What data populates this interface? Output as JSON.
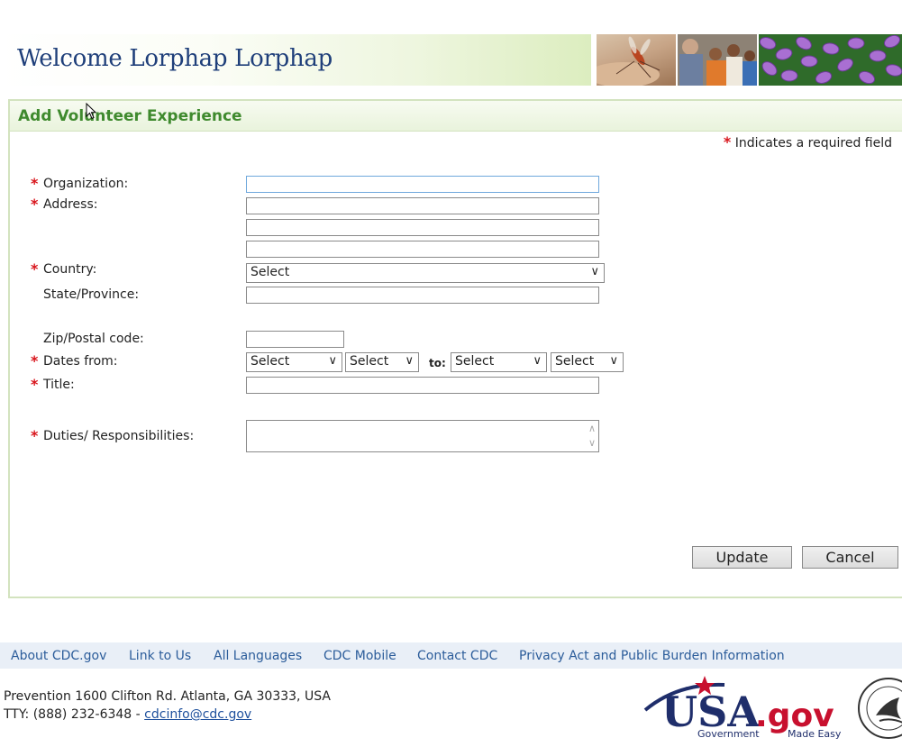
{
  "header": {
    "welcome": "Welcome Lorphap Lorphap"
  },
  "form": {
    "title": "Add Volunteer Experience",
    "required_note": "Indicates a required field",
    "required_mark": "*",
    "labels": {
      "organization": "Organization:",
      "address": "Address:",
      "country": "Country:",
      "state": "State/Province:",
      "zip": "Zip/Postal code:",
      "dates_from": "Dates from:",
      "to": "to:",
      "title": "Title:",
      "duties": "Duties/ Responsibilities:"
    },
    "selects": {
      "country": "Select",
      "from_month": "Select",
      "from_year": "Select",
      "to_month": "Select",
      "to_year": "Select"
    },
    "buttons": {
      "update": "Update",
      "cancel": "Cancel"
    }
  },
  "footer": {
    "nav": [
      "About CDC.gov",
      "Link to Us",
      "All Languages",
      "CDC Mobile",
      "Contact CDC",
      "Privacy Act and Public Burden Information"
    ],
    "address_line1": "Prevention   1600 Clifton Rd. Atlanta, GA 30333, USA",
    "address_line2_prefix": "TTY: (888) 232-6348 - ",
    "email": "cdcinfo@cdc.gov",
    "logo_main": "USA",
    "logo_gov": ".gov",
    "logo_tagline_left": "Government",
    "logo_tagline_right": "Made Easy"
  },
  "colors": {
    "title_green": "#3f8a2e",
    "welcome_blue": "#1f3f7a",
    "required_red": "#d8141b",
    "link_blue": "#2b5c9a"
  }
}
